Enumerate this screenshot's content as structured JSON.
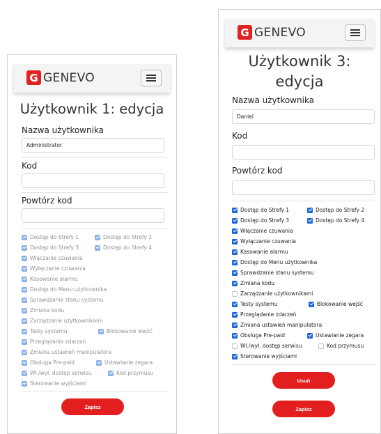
{
  "brand": {
    "name": "GENEVO",
    "mark": "G"
  },
  "form": {
    "username_label": "Nazwa użytkownika",
    "code_label": "Kod",
    "repeat_code_label": "Powtórz kod"
  },
  "left": {
    "title": "Użytkownik 1: edycja",
    "username_value": "Administrator",
    "code_value": "",
    "repeat_value": "",
    "permissions": [
      {
        "label": "Dostęp do Strefy 1",
        "checked": true
      },
      {
        "label": "Dostęp do Strefy 2",
        "checked": true
      },
      {
        "label": "Dostęp do Strefy 3",
        "checked": true
      },
      {
        "label": "Dostęp do Strefy 4",
        "checked": true
      },
      {
        "label": "Włączanie czuwania",
        "checked": true
      },
      {
        "label": "Wyłączanie czuwania",
        "checked": true
      },
      {
        "label": "Kasowanie alarmu",
        "checked": true
      },
      {
        "label": "Dostęp do Menu użytkownika",
        "checked": true
      },
      {
        "label": "Sprawdzanie stanu systemu",
        "checked": true
      },
      {
        "label": "Zmiana kodu",
        "checked": true
      },
      {
        "label": "Zarządzanie użytkownikami",
        "checked": true
      },
      {
        "label": "Testy systemu",
        "checked": true
      },
      {
        "label": "Blokowanie wejść",
        "checked": true
      },
      {
        "label": "Przeglądanie zdarzeń",
        "checked": true
      },
      {
        "label": "Zmiana ustawień manipulatora",
        "checked": true
      },
      {
        "label": "Obsługa Pre-paid",
        "checked": true
      },
      {
        "label": "Ustawianie zegara",
        "checked": true
      },
      {
        "label": "Wł./wył. dostęp serwisu",
        "checked": true
      },
      {
        "label": "Kod przymusu",
        "checked": true
      },
      {
        "label": "Sterowanie wyjściami",
        "checked": true
      }
    ],
    "save_label": "Zapisz"
  },
  "right": {
    "title": "Użytkownik 3: edycja",
    "username_value": "Daniel",
    "code_value": "",
    "repeat_value": "",
    "permissions": [
      {
        "label": "Dostęp do Strefy 1",
        "checked": true
      },
      {
        "label": "Dostęp do Strefy 2",
        "checked": true
      },
      {
        "label": "Dostęp do Strefy 3",
        "checked": true
      },
      {
        "label": "Dostęp do Strefy 4",
        "checked": true
      },
      {
        "label": "Włączanie czuwania",
        "checked": true
      },
      {
        "label": "Wyłączanie czuwania",
        "checked": true
      },
      {
        "label": "Kasowanie alarmu",
        "checked": true
      },
      {
        "label": "Dostęp do Menu użytkownika",
        "checked": true
      },
      {
        "label": "Sprawdzanie stanu systemu",
        "checked": true
      },
      {
        "label": "Zmiana kodu",
        "checked": true
      },
      {
        "label": "Zarządzanie użytkownikami",
        "checked": false
      },
      {
        "label": "Testy systemu",
        "checked": true
      },
      {
        "label": "Blokowanie wejść",
        "checked": true
      },
      {
        "label": "Przeglądanie zdarzeń",
        "checked": true
      },
      {
        "label": "Zmiana ustawień manipulatora",
        "checked": true
      },
      {
        "label": "Obsługa Pre-paid",
        "checked": true
      },
      {
        "label": "Ustawianie zegara",
        "checked": true
      },
      {
        "label": "Wł./wył. dostęp serwisu",
        "checked": false
      },
      {
        "label": "Kod przymusu",
        "checked": false
      },
      {
        "label": "Sterowanie wyjściami",
        "checked": true
      }
    ],
    "delete_label": "Usuń",
    "save_label": "Zapisz"
  },
  "colors": {
    "accent": "#e31e1e",
    "checkbox": "#1a66d9"
  },
  "icons": {
    "menu": "hamburger-icon",
    "logo": "genevo-logo-icon",
    "check": "checkmark-icon"
  }
}
